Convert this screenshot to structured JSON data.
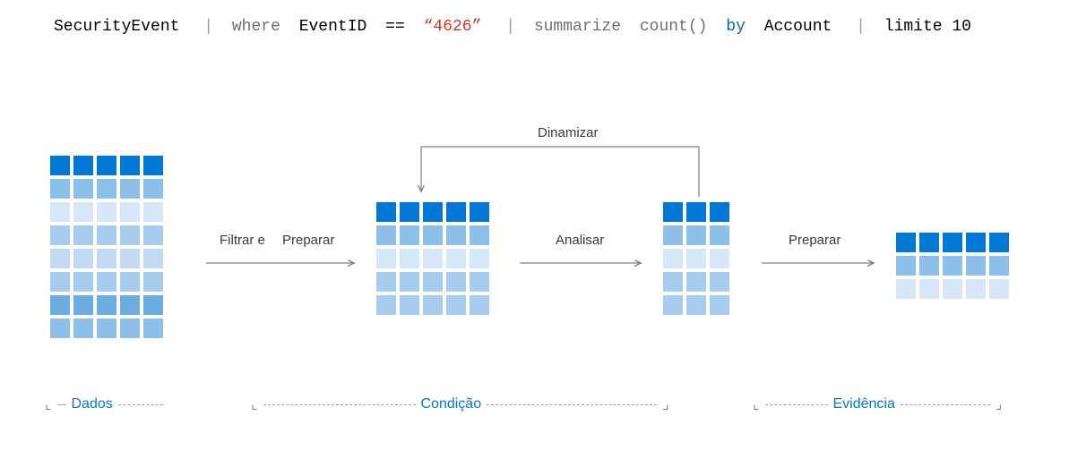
{
  "query": {
    "token1": "SecurityEvent",
    "pipe": "|",
    "where": "where",
    "field": "EventID",
    "eq": "==",
    "value": "“4626”",
    "summarize": "summarize",
    "countfn": "count()",
    "by": "by",
    "groupfield": "Account",
    "limit": "limite 10"
  },
  "labels": {
    "filter": "Filtrar e",
    "prepare1": "Preparar",
    "analyze": "Analisar",
    "prepare2": "Preparar",
    "pivot": "Dinamizar"
  },
  "sections": {
    "data": "Dados",
    "condition": "Condição",
    "evidence": "Evidência"
  },
  "chart_data": {
    "type": "diagram",
    "title": "KQL pipeline stages",
    "stages": [
      {
        "name": "Dados",
        "cols": 5,
        "rows": 8
      },
      {
        "name": "Condição-filter",
        "cols": 5,
        "rows": 5
      },
      {
        "name": "Condição-analyze",
        "cols": 3,
        "rows": 5
      },
      {
        "name": "Evidência",
        "cols": 5,
        "rows": 3
      }
    ],
    "arrows": [
      {
        "from": "Dados",
        "to": "Condição-filter",
        "label": "Filtrar e Preparar"
      },
      {
        "from": "Condição-filter",
        "to": "Condição-analyze",
        "label": "Analisar"
      },
      {
        "from": "Condição-analyze",
        "to": "Condição-filter",
        "label": "Dinamizar",
        "back": true
      },
      {
        "from": "Condição-analyze",
        "to": "Evidência",
        "label": "Preparar"
      }
    ]
  }
}
